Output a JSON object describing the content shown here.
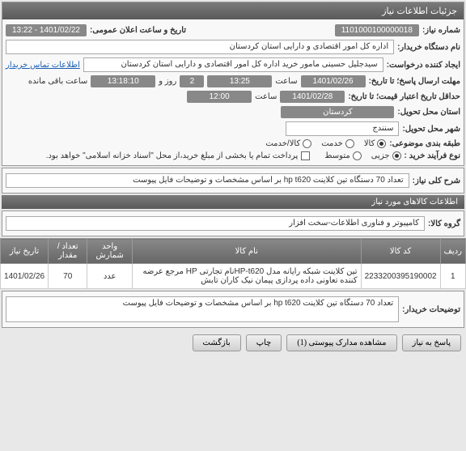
{
  "panel_title": "جزئیات اطلاعات نیاز",
  "fields": {
    "need_number_label": "شماره نیاز:",
    "need_number": "1101000100000018",
    "public_announce_label": "تاریخ و ساعت اعلان عمومی:",
    "public_announce": "1401/02/22 - 13:22",
    "buyer_org_label": "نام دستگاه خریدار:",
    "buyer_org": "اداره کل امور اقتصادی و دارایی استان کردستان",
    "requester_label": "ایجاد کننده درخواست:",
    "requester": "سیدجلیل حسینی مامور خرید اداره کل امور اقتصادی و دارایی استان کردستان",
    "buyer_contact_link": "اطلاعات تماس خریدار",
    "deadline_response_label": "مهلت ارسال پاسخ؛ تا تاریخ:",
    "deadline_date": "1401/02/26",
    "time_label": "ساعت",
    "deadline_time": "13:25",
    "days_count": "2",
    "days_and_label": "روز و",
    "countdown": "13:18:10",
    "remaining_label": "ساعت باقی مانده",
    "validity_label": "حداقل تاریخ اعتبار قیمت؛ تا تاریخ:",
    "validity_date": "1401/02/28",
    "validity_time": "12:00",
    "province_label": "استان محل تحویل:",
    "province": "کردستان",
    "city_label": "شهر محل تحویل:",
    "city": "سنندج",
    "category_label": "طبقه بندی موضوعی:",
    "cat_goods": "کالا",
    "cat_service": "خدمت",
    "cat_goods_service": "کالا/خدمت",
    "purchase_type_label": "نوع فرآیند خرید :",
    "pt_partial": "جزیی",
    "pt_medium": "متوسط",
    "payment_note": "پرداخت تمام یا بخشی از مبلغ خرید،از محل \"اسناد خزانه اسلامی\" خواهد بود.",
    "description_label": "شرح کلی نیاز:",
    "description": "تعداد 70 دستگاه تین کلاینت hp t620 بر اساس مشخصات و توضیحات فایل پیوست",
    "items_section": "اطلاعات کالاهای مورد نیاز",
    "goods_group_label": "گروه کالا:",
    "goods_group": "کامپیوتر و فناوری اطلاعات-سخت افزار",
    "buyer_notes_label": "توضیحات خریدار:",
    "buyer_notes": "تعداد 70 دستگاه تین کلاینت hp t620 بر اساس مشخصات و توضیحات فایل پیوست"
  },
  "table": {
    "headers": {
      "row": "ردیف",
      "code": "کد کالا",
      "name": "نام کالا",
      "unit": "واحد شمارش",
      "qty": "تعداد / مقدار",
      "date": "تاریخ نیاز"
    },
    "rows": [
      {
        "row": "1",
        "code": "2233200395190002",
        "name": "تین کلاینت شبکه رایانه مدل HP-t620نام تجارتی HP مرجع عرضه کننده تعاونی داده پردازی پیمان نیک کاران تابش",
        "unit": "عدد",
        "qty": "70",
        "date": "1401/02/26"
      }
    ]
  },
  "buttons": {
    "respond": "پاسخ به نیاز",
    "attachments": "مشاهده مدارک پیوستی (1)",
    "print": "چاپ",
    "back": "بازگشت"
  }
}
